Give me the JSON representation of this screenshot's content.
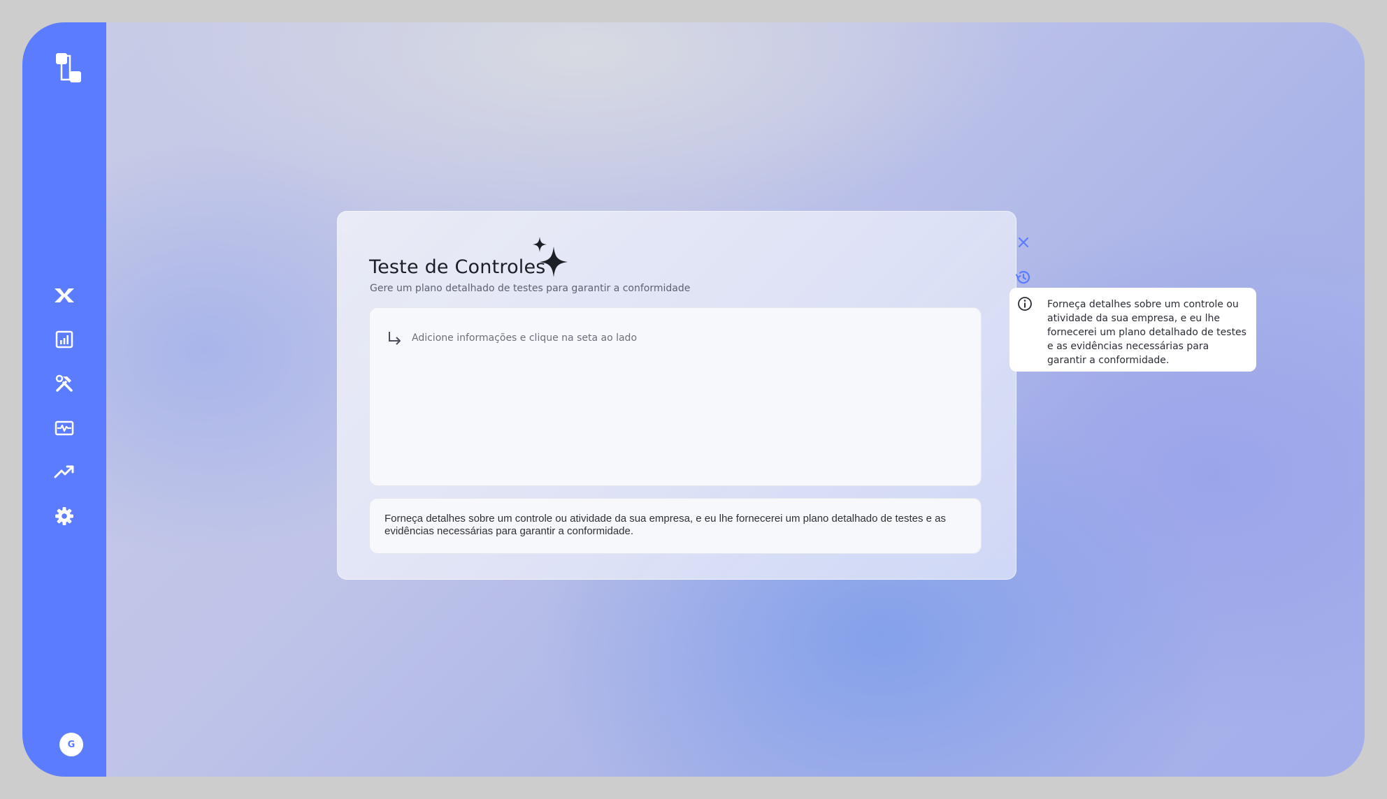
{
  "colors": {
    "sidebar": "#5b7cff",
    "accent": "#5b7cff",
    "text_primary": "#1d1f26"
  },
  "sidebar": {
    "logo": "app-logo",
    "items": [
      {
        "icon": "x-logo-icon"
      },
      {
        "icon": "report-chart-icon"
      },
      {
        "icon": "tools-icon"
      },
      {
        "icon": "activity-monitor-icon"
      },
      {
        "icon": "trending-up-icon"
      },
      {
        "icon": "gear-icon"
      }
    ],
    "avatar_initial": "G"
  },
  "modal": {
    "title": "Teste de Controles",
    "subtitle": "Gere um plano detalhado de testes para garantir a conformidade",
    "input_placeholder": "Adicione informações e clique na seta ao lado",
    "description": "Forneça detalhes sobre um controle ou atividade da sua empresa, e eu lhe fornecerei um plano detalhado de testes e as evidências necessárias para garantir a conformidade.",
    "actions": [
      "close-icon",
      "history-icon",
      "info-icon"
    ]
  },
  "tooltip": {
    "text": "Forneça detalhes sobre um controle ou atividade da sua empresa, e eu lhe fornecerei um plano detalhado de testes e as evidências necessárias para garantir a conformidade."
  }
}
